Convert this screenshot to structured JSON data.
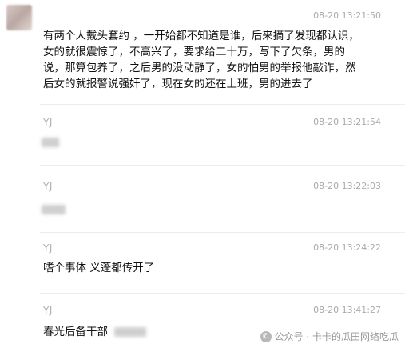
{
  "messages": [
    {
      "name": "",
      "time": "08-20 13:21:50",
      "text": "有两个人戴头套约  ，一开始都不知道是谁，后来摘了发现都认识，女的就很震惊了，不高兴了，要求给二十万，写下了欠条，男的说，那算包养了，之后男的没动静了，女的怕男的举报他敲诈，然后女的就报警说强奸了，现在女的还在上班，男的进去了"
    },
    {
      "name": "YJ",
      "time": "08-20 13:21:54",
      "text": ""
    },
    {
      "name": "YJ",
      "time": "08-20 13:22:03",
      "text": ""
    },
    {
      "name": "YJ",
      "time": "08-20 13:24:22",
      "text": "嗜个事体 义蓬都传开了"
    },
    {
      "name": "YJ",
      "time": "08-20 13:41:27",
      "text": "春光后备干部"
    }
  ],
  "watermark": {
    "text": "公众号 · 卡卡的瓜田网络吃瓜",
    "icon": "wechat-icon"
  }
}
